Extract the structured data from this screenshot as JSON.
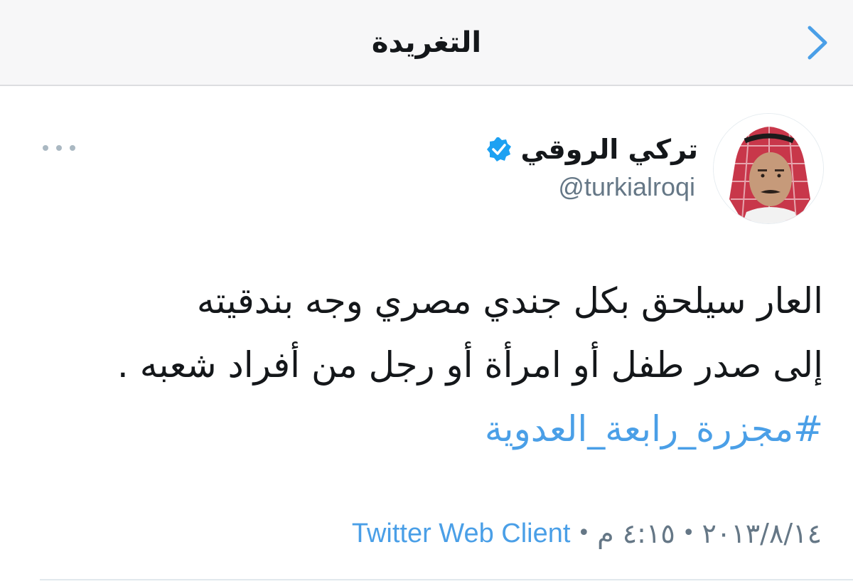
{
  "header": {
    "title": "التغريدة",
    "back_icon": "chevron-right-icon"
  },
  "tweet": {
    "author": {
      "display_name": "تركي الروقي",
      "handle": "@turkialroqi",
      "verified": true,
      "verified_icon": "verified-badge-icon",
      "avatar": "avatar-photo"
    },
    "more_icon": "more-horizontal-icon",
    "body_lines": [
      "العار سيلحق بكل جندي مصري وجه بندقيته",
      "إلى صدر طفل أو امرأة أو رجل من أفراد شعبه ."
    ],
    "hashtag": "#مجزرة_رابعة_العدوية",
    "date": "٢٠١٣/٨/١٤",
    "time": "٤:١٥ م",
    "separator": "•",
    "source": "Twitter Web Client"
  },
  "colors": {
    "link": "#4a9fe7",
    "verified": "#1da1f2",
    "secondary_text": "#657786",
    "header_bg": "#f7f7f8"
  }
}
